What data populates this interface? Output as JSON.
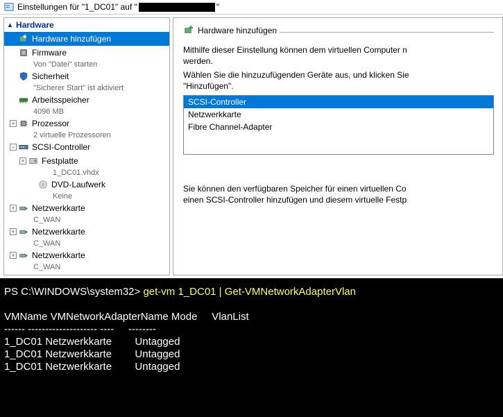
{
  "titlebar": {
    "prefix": "Einstellungen für \"1_DC01\" auf \"",
    "suffix": "\""
  },
  "tree": {
    "header": "Hardware",
    "items": [
      {
        "label": "Hardware hinzufügen",
        "sub": null,
        "selected": true
      },
      {
        "label": "Firmware",
        "sub": "Von \"Datei\" starten"
      },
      {
        "label": "Sicherheit",
        "sub": "\"Sicherer Start\" ist aktiviert"
      },
      {
        "label": "Arbeitsspeicher",
        "sub": "4096 MB"
      },
      {
        "label": "Prozessor",
        "sub": "2 virtuelle Prozessoren",
        "expandable": true,
        "expanded": false
      },
      {
        "label": "SCSI-Controller",
        "expandable": true,
        "expanded": true,
        "children": [
          {
            "label": "Festplatte",
            "sub": "1_DC01.vhdx",
            "expandable": true,
            "expanded": false
          },
          {
            "label": "DVD-Laufwerk",
            "sub": "Keine"
          }
        ]
      },
      {
        "label": "Netzwerkkarte",
        "sub": "C_WAN",
        "expandable": true,
        "expanded": false
      },
      {
        "label": "Netzwerkkarte",
        "sub": "C_WAN",
        "expandable": true,
        "expanded": false
      },
      {
        "label": "Netzwerkkarte",
        "sub": "C_WAN",
        "expandable": true,
        "expanded": false
      }
    ]
  },
  "detail": {
    "heading": "Hardware hinzufügen",
    "p1": "Mithilfe dieser Einstellung können dem virtuellen Computer n",
    "p1b": "werden.",
    "p2a": "Wählen Sie die hinzuzufügenden Geräte aus, und klicken Sie",
    "p2b": "\"Hinzufügen\".",
    "options": [
      {
        "label": "SCSI-Controller",
        "selected": true
      },
      {
        "label": "Netzwerkkarte"
      },
      {
        "label": "Fibre Channel-Adapter"
      }
    ],
    "p3a": "Sie können den verfügbaren Speicher für einen virtuellen Co",
    "p3b": "einen SCSI-Controller hinzufügen und diesem virtuelle Festp"
  },
  "console": {
    "prompt": "PS C:\\WINDOWS\\system32> ",
    "cmd": "get-vm 1_DC01 | Get-VMNetworkAdapterVlan",
    "header": "VMName VMNetworkAdapterName Mode     VlanList",
    "dashes": "------ -------------------- ----     --------",
    "rows": [
      "1_DC01 Netzwerkkarte        Untagged",
      "1_DC01 Netzwerkkarte        Untagged",
      "1_DC01 Netzwerkkarte        Untagged"
    ]
  }
}
